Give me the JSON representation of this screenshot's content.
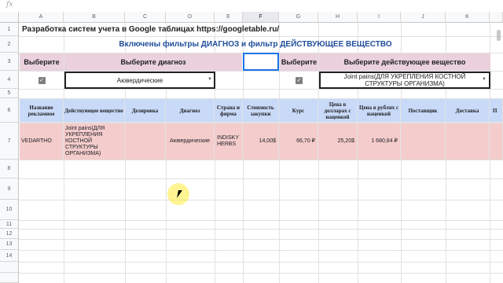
{
  "formula_bar": {
    "fx_label": "fx"
  },
  "columns": [
    "A",
    "B",
    "C",
    "D",
    "E",
    "F",
    "G",
    "H",
    "I",
    "J",
    "K"
  ],
  "selected_column": "F",
  "rows": [
    "1",
    "2",
    "3",
    "4",
    "5",
    "6",
    "7",
    "8",
    "9",
    "10",
    "11",
    "12",
    "13",
    "14"
  ],
  "sheet": {
    "row1_title": "Разработка систем учета в Google таблицах https://googletable.ru/",
    "row2_heading": "Включены фильтры ДИАГНОЗ и фильтр ДЕЙСТВУЮЩЕЕ ВЕЩЕСТВО",
    "row3": {
      "a_label": "Выберите",
      "bd_label": "Выберите диагноз",
      "g_label": "Выберите",
      "hk_label": "Выберите действующее вещество"
    },
    "row4": {
      "diagnosis_value": "Аюверди­ческие",
      "substance_value": "Joint pains(ДЛЯ УКРЕПЛЕНИЯ КОСТНОЙ СТРУКТУРЫ ОРГАНИЗМА)",
      "checkbox_a": true,
      "checkbox_g": true
    },
    "headers": [
      "Название рекламное",
      "Действующее вещество",
      "Дозировка",
      "Диагноз",
      "Страна и фирма",
      "Стоимость закупки",
      "Курс",
      "Цена в долларах с наценкой",
      "Цена в рублях с наценкой",
      "Поставщик",
      "Доставка",
      "П"
    ],
    "row7": {
      "name": "VEDARTHO",
      "substance": "Joint pains(ДЛЯ УКРЕПЛЕНИЯ КОСТНОЙ СТРУКТУРЫ ОРГАНИЗМА)",
      "dosage": "",
      "diagnosis": "Аюверди­ческие",
      "country": "INDISKY HERBS",
      "cost": "14,00$",
      "rate": "66,70 ₽",
      "price_usd": "25,20$",
      "price_rub": "1 680,84 ₽",
      "supplier": "",
      "delivery": ""
    }
  },
  "colors": {
    "pink": "#ead1dc",
    "header_blue": "#c9daf8",
    "row_red": "#f4cccc",
    "title_blue": "#1f4e9a",
    "selection": "#1a73e8"
  }
}
